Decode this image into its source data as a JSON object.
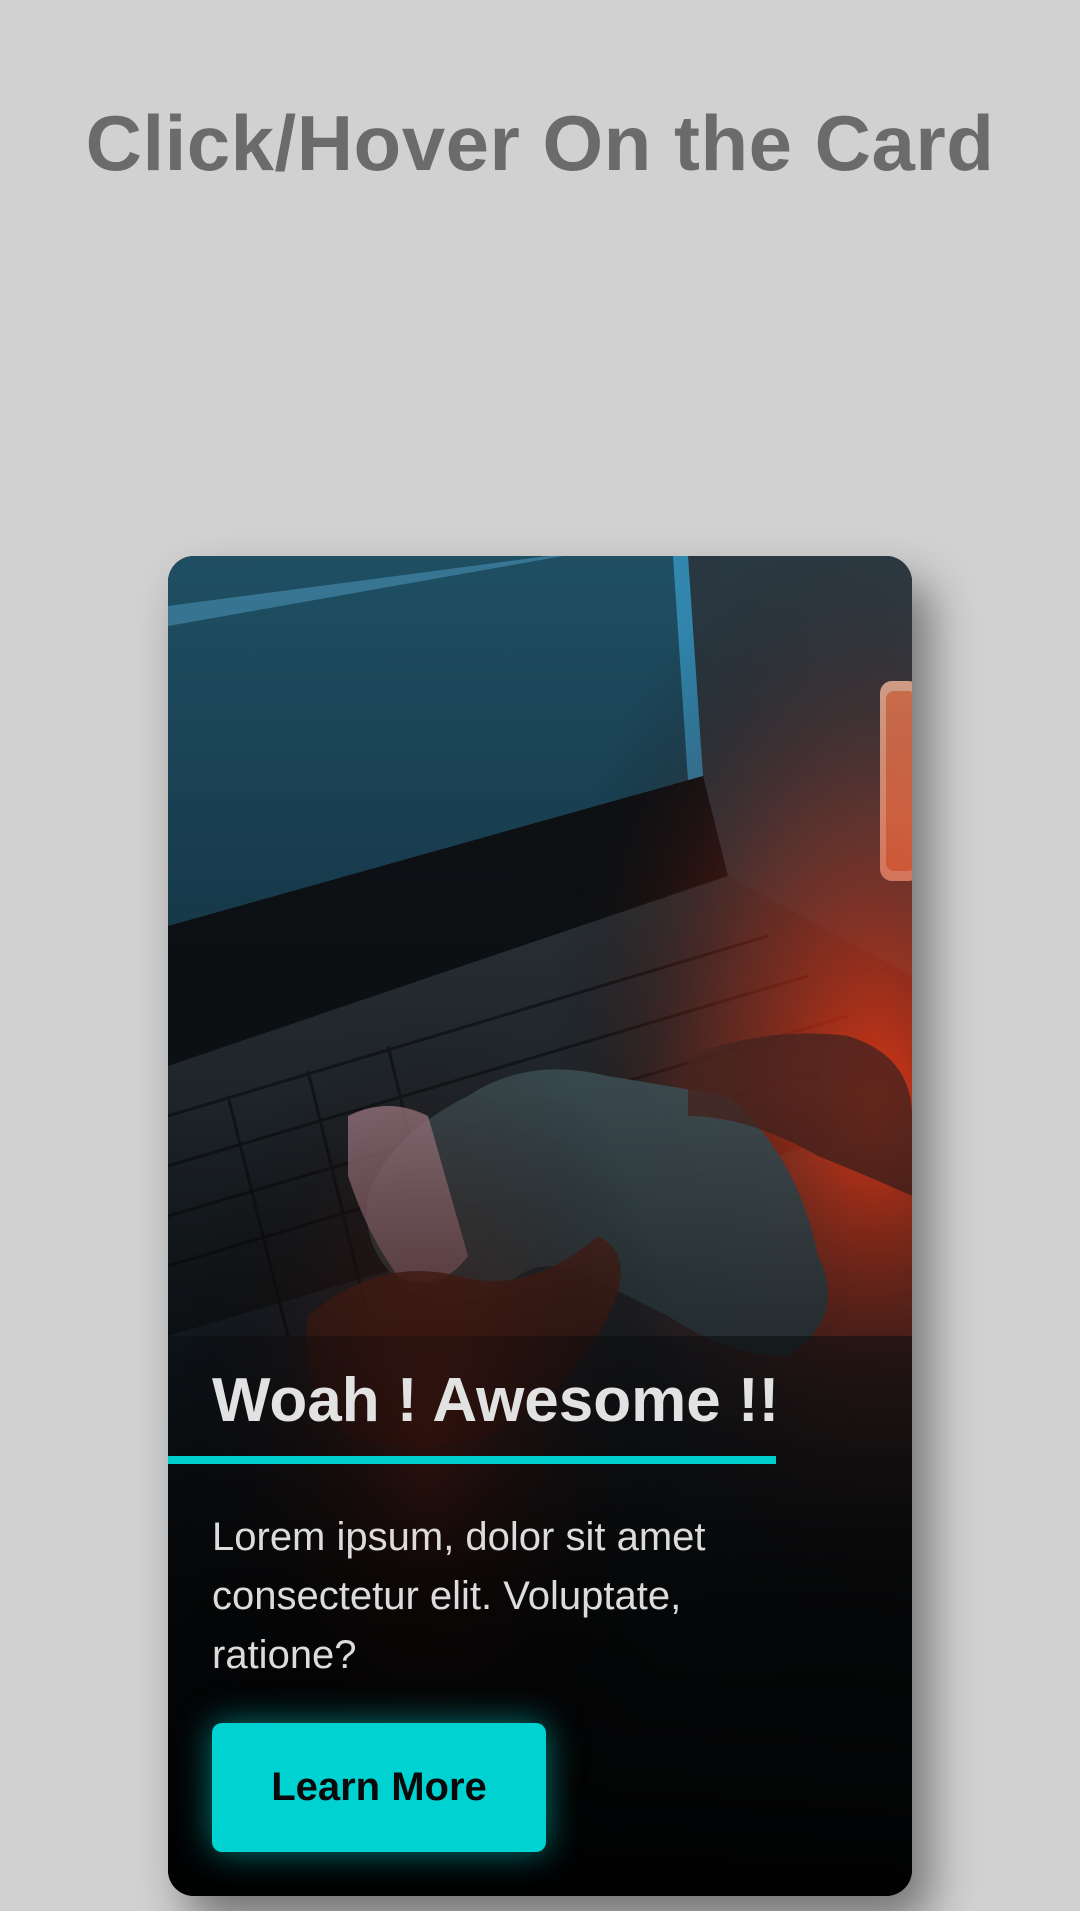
{
  "page": {
    "heading": "Click/Hover On the Card"
  },
  "card": {
    "title": "Woah ! Awesome !!",
    "description": "Lorem ipsum, dolor sit amet consectetur elit. Voluptate, ratione?",
    "button_label": "Learn More",
    "image": "laptop-gaming-controller-photo"
  },
  "colors": {
    "background": "#d1d1d1",
    "heading": "#6b6b6b",
    "accent": "#00d2d2",
    "card_text": "#e2e2e2"
  }
}
